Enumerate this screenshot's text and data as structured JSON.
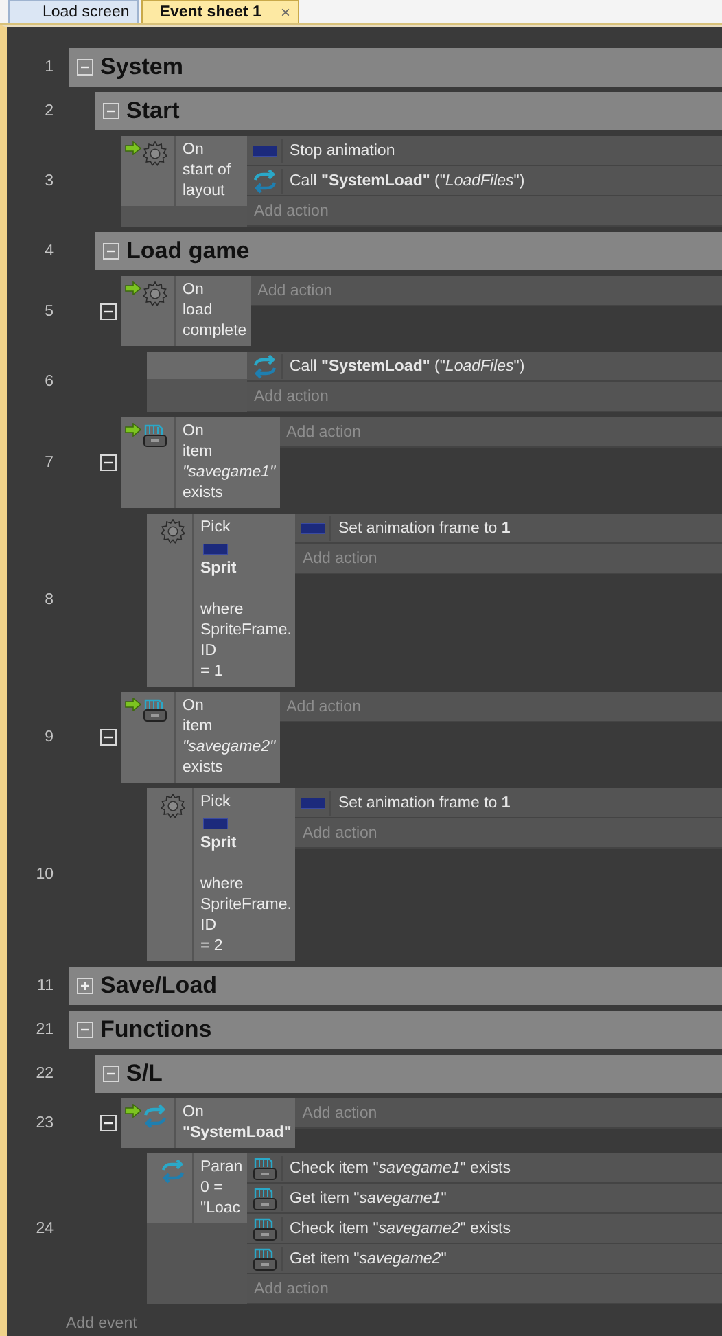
{
  "tabs": [
    {
      "label": "Load screen",
      "selected": false
    },
    {
      "label": "Event sheet 1",
      "selected": true,
      "close": "×"
    }
  ],
  "events": [
    {
      "kind": "group",
      "number": "1",
      "title": "System",
      "expanded": true,
      "children": [
        {
          "kind": "group",
          "number": "2",
          "title": "Start",
          "expanded": true,
          "children": [
            {
              "kind": "event",
              "number": "3",
              "condition": {
                "trigger": true,
                "kind": "system",
                "parts": [
                  {
                    "kind": "text",
                    "lines": [
                      "On",
                      "start of",
                      "layout"
                    ]
                  }
                ]
              },
              "actions": [
                {
                  "kind": "sprite",
                  "text": "Stop animation"
                },
                {
                  "kind": "function",
                  "text": "Call **\"SystemLoad\"** (\"*LoadFiles*\")"
                }
              ],
              "add_action": "Add action"
            }
          ]
        },
        {
          "kind": "group",
          "number": "4",
          "title": "Load game",
          "expanded": true,
          "children": [
            {
              "kind": "event",
              "number": "5",
              "expanded": true,
              "condition": {
                "trigger": true,
                "kind": "system",
                "parts": [
                  {
                    "kind": "text",
                    "lines": [
                      "On",
                      "load",
                      "complete"
                    ]
                  }
                ]
              },
              "add_action": "Add action",
              "children": [
                {
                  "kind": "event",
                  "number": "6",
                  "actions": [
                    {
                      "kind": "function",
                      "text": "Call **\"SystemLoad\"** (\"*LoadFiles*\")"
                    }
                  ],
                  "add_action": "Add action"
                }
              ]
            },
            {
              "kind": "event",
              "number": "7",
              "expanded": true,
              "condition": {
                "trigger": true,
                "kind": "storage",
                "parts": [
                  {
                    "kind": "text",
                    "lines": [
                      "On",
                      "item",
                      "*\"savegame1\"*",
                      "exists"
                    ]
                  }
                ]
              },
              "add_action": "Add action",
              "children": [
                {
                  "kind": "event",
                  "number": "8",
                  "condition": {
                    "trigger": false,
                    "kind": "system",
                    "parts": [
                      {
                        "kind": "text",
                        "lines": [
                          "Pick"
                        ]
                      },
                      {
                        "kind": "object"
                      },
                      {
                        "kind": "text",
                        "lines": [
                          "**Sprit**"
                        ]
                      },
                      {
                        "kind": "gap"
                      },
                      {
                        "kind": "text",
                        "lines": [
                          "where",
                          "SpriteFrame.",
                          "ID",
                          "= 1"
                        ]
                      }
                    ]
                  },
                  "actions": [
                    {
                      "kind": "sprite",
                      "text": "Set animation frame to **1**"
                    }
                  ],
                  "add_action": "Add action"
                }
              ]
            },
            {
              "kind": "event",
              "number": "9",
              "expanded": true,
              "condition": {
                "trigger": true,
                "kind": "storage",
                "parts": [
                  {
                    "kind": "text",
                    "lines": [
                      "On",
                      "item",
                      "*\"savegame2\"*",
                      "exists"
                    ]
                  }
                ]
              },
              "add_action": "Add action",
              "children": [
                {
                  "kind": "event",
                  "number": "10",
                  "condition": {
                    "trigger": false,
                    "kind": "system",
                    "parts": [
                      {
                        "kind": "text",
                        "lines": [
                          "Pick"
                        ]
                      },
                      {
                        "kind": "object"
                      },
                      {
                        "kind": "text",
                        "lines": [
                          "**Sprit**"
                        ]
                      },
                      {
                        "kind": "gap"
                      },
                      {
                        "kind": "text",
                        "lines": [
                          "where",
                          "SpriteFrame.",
                          "ID",
                          "= 2"
                        ]
                      }
                    ]
                  },
                  "actions": [
                    {
                      "kind": "sprite",
                      "text": "Set animation frame to **1**"
                    }
                  ],
                  "add_action": "Add action"
                }
              ]
            }
          ]
        }
      ]
    },
    {
      "kind": "group",
      "number": "11",
      "title": "Save/Load",
      "expanded": false
    },
    {
      "kind": "group",
      "number": "21",
      "title": "Functions",
      "expanded": true,
      "children": [
        {
          "kind": "group",
          "number": "22",
          "title": "S/L",
          "expanded": true,
          "children": [
            {
              "kind": "event",
              "number": "23",
              "expanded": true,
              "condition": {
                "trigger": true,
                "kind": "function",
                "parts": [
                  {
                    "kind": "text",
                    "lines": [
                      "On",
                      "**\"SystemLoad\"**"
                    ]
                  }
                ]
              },
              "add_action": "Add action",
              "children": [
                {
                  "kind": "event",
                  "number": "24",
                  "condition": {
                    "trigger": false,
                    "kind": "function",
                    "parts": [
                      {
                        "kind": "text",
                        "lines": [
                          "Paran",
                          "0 =",
                          "\"Loac"
                        ]
                      }
                    ]
                  },
                  "actions": [
                    {
                      "kind": "storage",
                      "text": "Check item \"*savegame1*\" exists"
                    },
                    {
                      "kind": "storage",
                      "text": "Get item \"*savegame1*\""
                    },
                    {
                      "kind": "storage",
                      "text": "Check item \"*savegame2*\" exists"
                    },
                    {
                      "kind": "storage",
                      "text": "Get item \"*savegame2*\""
                    }
                  ],
                  "add_action": "Add action"
                }
              ]
            }
          ]
        }
      ]
    }
  ],
  "add_event": "Add event"
}
